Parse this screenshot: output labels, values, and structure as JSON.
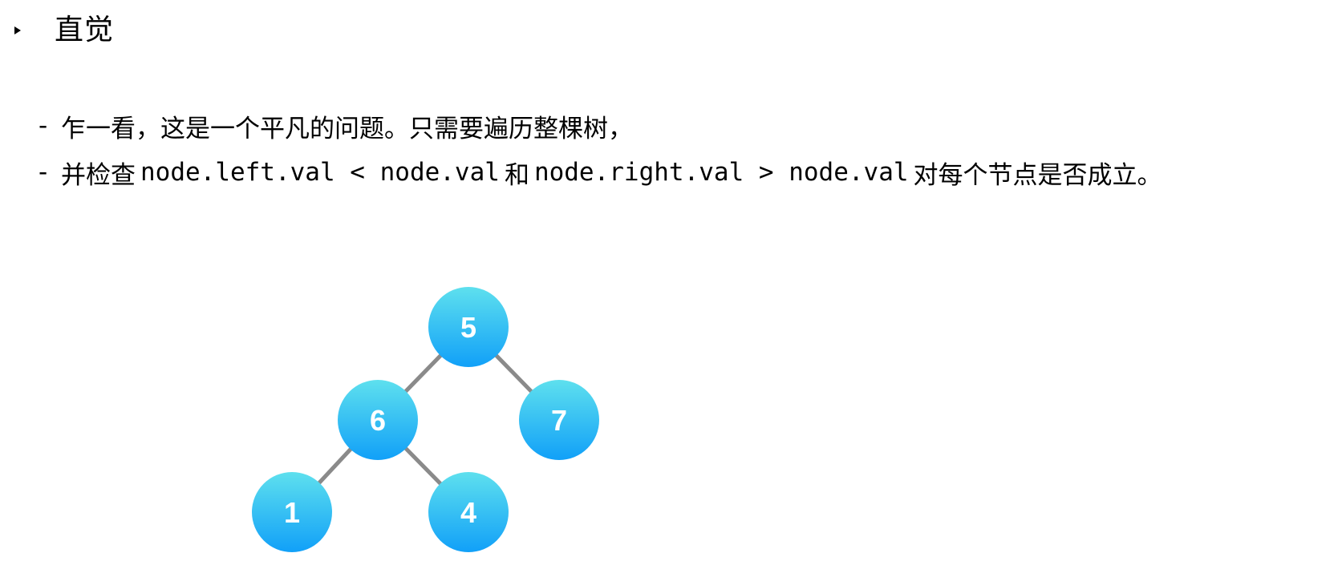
{
  "heading": {
    "bullet_icon": "triangle-right",
    "title": "直觉"
  },
  "bullets": [
    {
      "dash": "-",
      "text": "乍一看，这是一个平凡的问题。只需要遍历整棵树，"
    },
    {
      "dash": "-",
      "prefix": "并检查",
      "code1": "node.left.val < node.val",
      "middle": "和",
      "code2": "node.right.val > node.val",
      "suffix": "对每个节点是否成立。"
    }
  ],
  "tree": {
    "node_colors": {
      "top": "#5ee0ee",
      "bottom": "#11a0f8"
    },
    "edge_color": "#8a8a8a",
    "nodes": [
      {
        "id": "n5",
        "label": "5"
      },
      {
        "id": "n6",
        "label": "6"
      },
      {
        "id": "n7",
        "label": "7"
      },
      {
        "id": "n1",
        "label": "1"
      },
      {
        "id": "n4",
        "label": "4"
      }
    ],
    "edges": [
      {
        "from": "n5",
        "to": "n6"
      },
      {
        "from": "n5",
        "to": "n7"
      },
      {
        "from": "n6",
        "to": "n1"
      },
      {
        "from": "n6",
        "to": "n4"
      }
    ]
  }
}
